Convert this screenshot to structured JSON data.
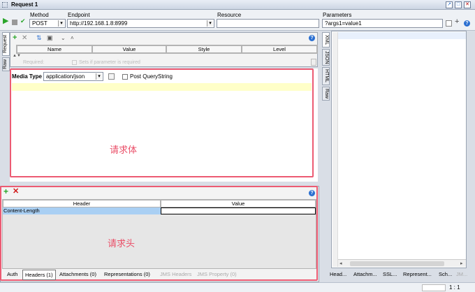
{
  "window": {
    "title": "Request 1"
  },
  "toolbar": {
    "method_label": "Method",
    "method_value": "POST",
    "endpoint_label": "Endpoint",
    "endpoint_value": "http://192.168.1.8:8999",
    "resource_label": "Resource",
    "resource_value": "",
    "parameters_label": "Parameters",
    "parameters_value": "?args1=value1"
  },
  "params_table": {
    "headers": [
      "Name",
      "Value",
      "Style",
      "Level"
    ],
    "row_placeholder_required": "Required:",
    "row_placeholder_sets": "Sets if parameter is required"
  },
  "left_tabs": [
    "Request",
    "Raw"
  ],
  "body": {
    "media_type_label": "Media Type",
    "media_type_value": "application/json",
    "post_query_label": "Post QueryString",
    "annotation": "请求体"
  },
  "headers_table": {
    "headers": [
      "Header",
      "Value"
    ],
    "rows": [
      {
        "header": "Content-Length",
        "value": ""
      }
    ],
    "annotation": "请求头"
  },
  "bottom_tabs": [
    {
      "label": "Auth",
      "active": false,
      "disabled": false
    },
    {
      "label": "Headers (1)",
      "active": true,
      "disabled": false
    },
    {
      "label": "Attachments (0)",
      "active": false,
      "disabled": false
    },
    {
      "label": "Representations (0)",
      "active": false,
      "disabled": false
    },
    {
      "label": "JMS Headers",
      "active": false,
      "disabled": true
    },
    {
      "label": "JMS Property (0)",
      "active": false,
      "disabled": true
    }
  ],
  "response_tabs": [
    "XML",
    "JSON",
    "HTML",
    "Raw"
  ],
  "response_bottom_tabs": [
    "Head...",
    "Attachm...",
    "SSL...",
    "Represent...",
    "Sch...",
    "JM..."
  ],
  "status": {
    "position": "1 : 1"
  }
}
